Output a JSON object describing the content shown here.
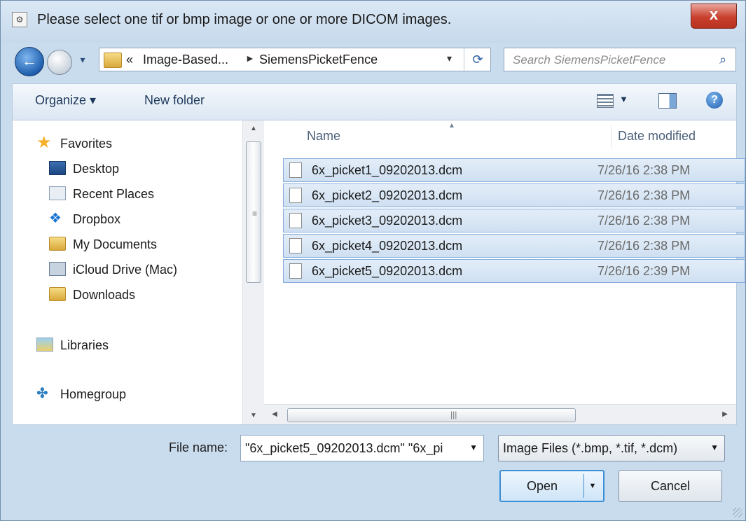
{
  "window": {
    "title": "Please select one tif or bmp image or one or more DICOM images.",
    "close_label": "x"
  },
  "navbar": {
    "breadcrumbs": [
      "Image-Based...",
      "SiemensPicketFence"
    ],
    "crumb_prefix": "«",
    "separator": "►",
    "search_placeholder": "Search SiemensPicketFence"
  },
  "toolbar": {
    "organize_label": "Organize ▾",
    "new_folder_label": "New folder",
    "views_icon": "details-view-icon",
    "preview_icon": "preview-pane-icon",
    "help_icon": "help-icon"
  },
  "sidebar": {
    "favorites_label": "Favorites",
    "items": [
      {
        "label": "Desktop",
        "icon": "desktop-icon"
      },
      {
        "label": "Recent Places",
        "icon": "recent-places-icon"
      },
      {
        "label": "Dropbox",
        "icon": "dropbox-icon"
      },
      {
        "label": "My Documents",
        "icon": "folder-icon"
      },
      {
        "label": "iCloud Drive (Mac)",
        "icon": "cloud-drive-icon"
      },
      {
        "label": "Downloads",
        "icon": "folder-icon"
      }
    ],
    "libraries_label": "Libraries",
    "homegroup_label": "Homegroup"
  },
  "file_list": {
    "columns": [
      "Name",
      "Date modified"
    ],
    "rows": [
      {
        "name": "6x_picket1_09202013.dcm",
        "date": "7/26/16 2:38 PM",
        "selected": true
      },
      {
        "name": "6x_picket2_09202013.dcm",
        "date": "7/26/16 2:38 PM",
        "selected": true
      },
      {
        "name": "6x_picket3_09202013.dcm",
        "date": "7/26/16 2:38 PM",
        "selected": true
      },
      {
        "name": "6x_picket4_09202013.dcm",
        "date": "7/26/16 2:38 PM",
        "selected": true
      },
      {
        "name": "6x_picket5_09202013.dcm",
        "date": "7/26/16 2:39 PM",
        "selected": true
      }
    ]
  },
  "footer": {
    "file_name_label": "File name:",
    "file_name_value": "\"6x_picket5_09202013.dcm\" \"6x_pi",
    "file_type_value": "Image Files (*.bmp, *.tif, *.dcm)",
    "open_label": "Open",
    "cancel_label": "Cancel"
  },
  "colors": {
    "accent": "#3c8fd6",
    "selection": "#cfe0f2",
    "close_red": "#c9402e"
  }
}
